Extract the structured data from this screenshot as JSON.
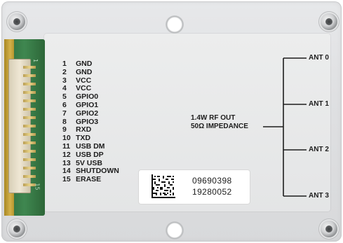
{
  "pinout": [
    {
      "num": "1",
      "name": "GND"
    },
    {
      "num": "2",
      "name": "GND"
    },
    {
      "num": "3",
      "name": "VCC"
    },
    {
      "num": "4",
      "name": "VCC"
    },
    {
      "num": "5",
      "name": "GPIO0"
    },
    {
      "num": "6",
      "name": "GPIO1"
    },
    {
      "num": "7",
      "name": "GPIO2"
    },
    {
      "num": "8",
      "name": "GPIO3"
    },
    {
      "num": "9",
      "name": "RXD"
    },
    {
      "num": "10",
      "name": "TXD"
    },
    {
      "num": "11",
      "name": "USB DM"
    },
    {
      "num": "12",
      "name": "USB DP"
    },
    {
      "num": "13",
      "name": "5V USB"
    },
    {
      "num": "14",
      "name": "SHUTDOWN"
    },
    {
      "num": "15",
      "name": "ERASE"
    }
  ],
  "rf_output": {
    "line1": "1.4W RF OUT",
    "line2": "50Ω IMPEDANCE"
  },
  "antennas": [
    "ANT 0",
    "ANT 1",
    "ANT 2",
    "ANT 3"
  ],
  "pcb_marks": {
    "top": "1",
    "bottom": "15"
  },
  "serial_label": {
    "line1": "09690398",
    "line2": "19280052"
  },
  "colors": {
    "housing": "#e2e3e5",
    "pcb": "#3a7c49",
    "text": "#1d1d1d"
  }
}
